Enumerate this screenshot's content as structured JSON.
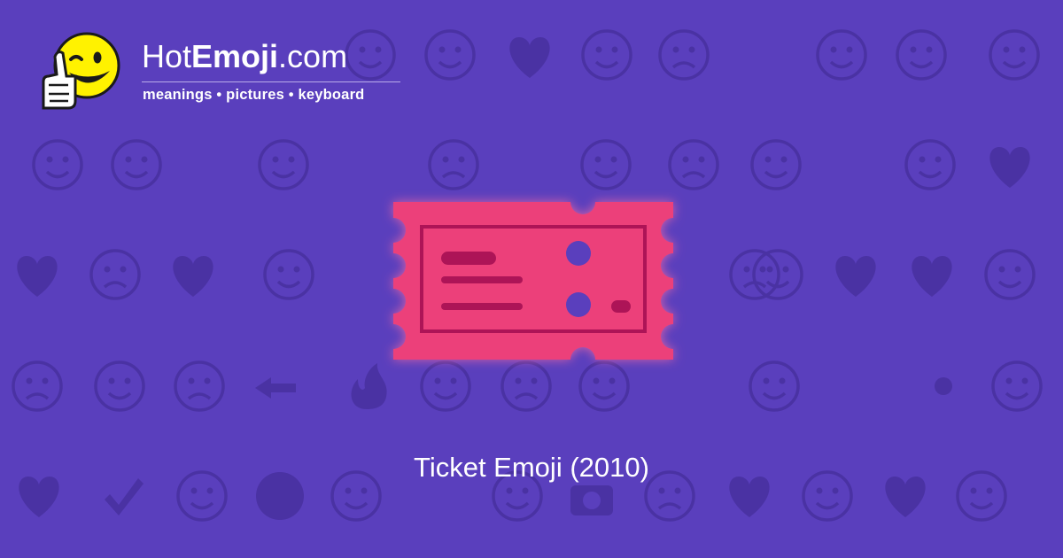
{
  "brand": {
    "name_prefix": "Hot",
    "name_bold": "Emoji",
    "name_suffix": ".com",
    "tagline": "meanings • pictures • keyboard"
  },
  "emoji": {
    "icon": "ticket-icon",
    "caption": "Ticket Emoji (2010)"
  },
  "colors": {
    "background": "#5a3fbd",
    "pattern": "#4a32a3",
    "ticket": "#ec407a",
    "ticket_dark": "#ad1457",
    "text": "#ffffff",
    "mascot": "#fff200"
  }
}
